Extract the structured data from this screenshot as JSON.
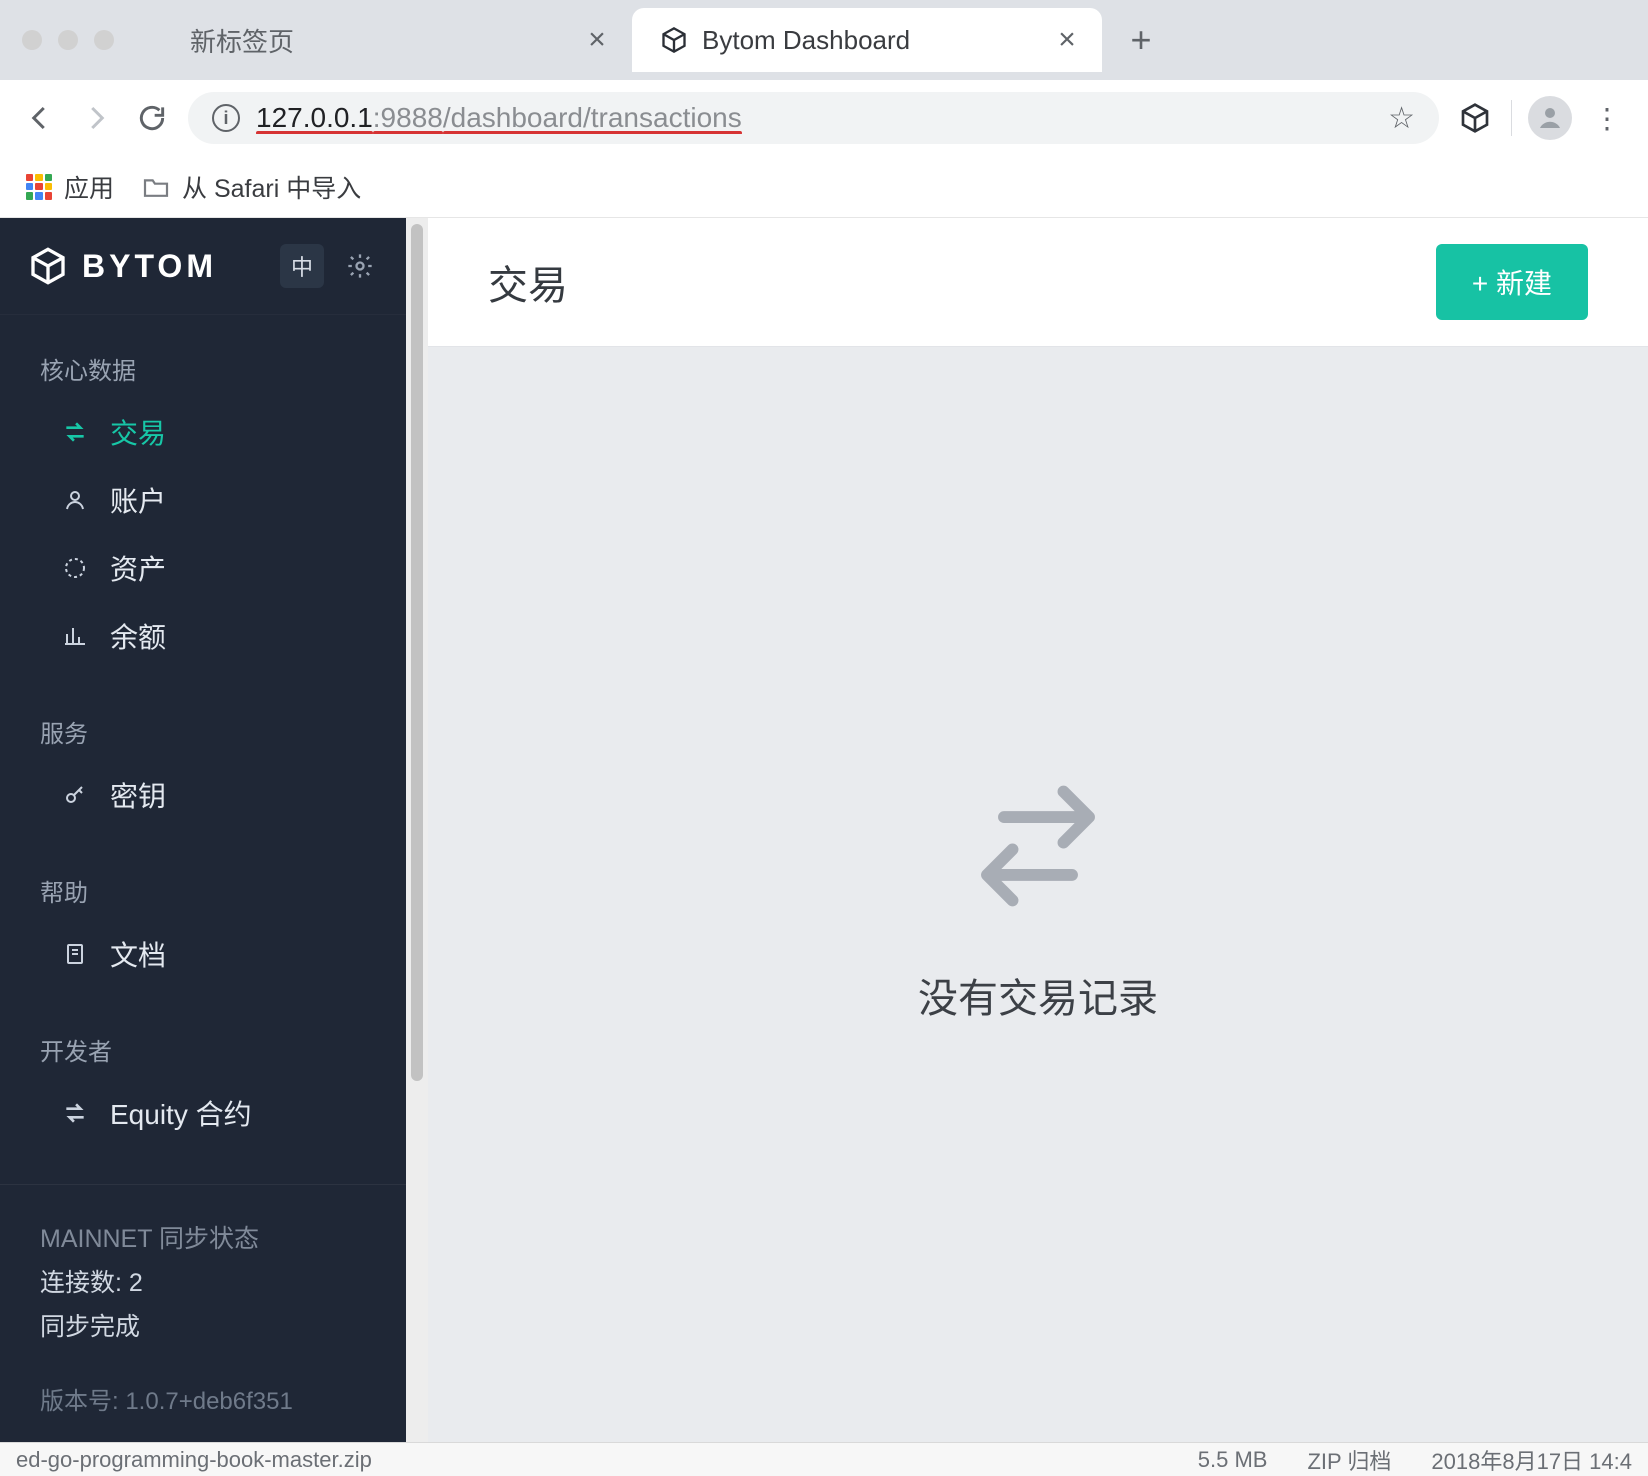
{
  "browser": {
    "tabs": [
      {
        "label": "新标签页",
        "active": false
      },
      {
        "label": "Bytom Dashboard",
        "active": true
      }
    ],
    "url_host": "127.0.0.1",
    "url_port": ":9888",
    "url_path": "/dashboard/transactions",
    "bookmarks": {
      "apps_label": "应用",
      "import_label": "从 Safari 中导入"
    }
  },
  "sidebar": {
    "brand": "BYTOM",
    "lang_badge": "中",
    "sections": {
      "core": {
        "heading": "核心数据",
        "items": [
          "交易",
          "账户",
          "资产",
          "余额"
        ]
      },
      "services": {
        "heading": "服务",
        "items": [
          "密钥"
        ]
      },
      "help": {
        "heading": "帮助",
        "items": [
          "文档"
        ]
      },
      "dev": {
        "heading": "开发者",
        "items": [
          "Equity 合约"
        ]
      }
    },
    "sync": {
      "title": "MAINNET 同步状态",
      "connections_label": "连接数: 2",
      "status": "同步完成"
    },
    "version_label": "版本号: 1.0.7+deb6f351"
  },
  "page": {
    "title": "交易",
    "new_button": "+ 新建",
    "empty_message": "没有交易记录"
  },
  "download": {
    "filename": "ed-go-programming-book-master.zip",
    "size": "5.5 MB",
    "kind": "ZIP 归档",
    "date": "2018年8月17日 14:4"
  },
  "apps_icon_colors": [
    "#e94435",
    "#fabd03",
    "#34a853",
    "#4285f4",
    "#e94435",
    "#fabd03",
    "#34a853",
    "#4285f4",
    "#e94435"
  ]
}
